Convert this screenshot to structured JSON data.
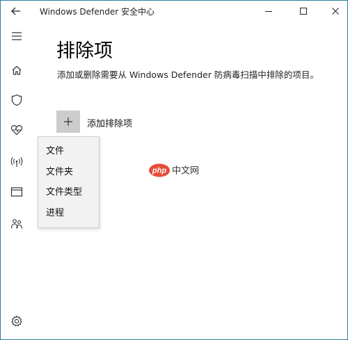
{
  "window": {
    "title": "Windows Defender 安全中心",
    "accent_color": "#2d7d9a"
  },
  "titlebar": {
    "back_icon": "arrow-left-icon",
    "minimize_icon": "minimize-icon",
    "maximize_icon": "maximize-icon",
    "close_icon": "close-icon"
  },
  "rail": {
    "items": [
      {
        "icon": "hamburger-menu-icon"
      },
      {
        "icon": "home-icon"
      },
      {
        "icon": "shield-icon"
      },
      {
        "icon": "heart-pulse-icon"
      },
      {
        "icon": "wireless-signal-icon"
      },
      {
        "icon": "browser-window-icon"
      },
      {
        "icon": "family-icon"
      },
      {
        "icon": "gear-icon"
      }
    ]
  },
  "main": {
    "title": "排除项",
    "description": "添加或删除需要从 Windows Defender 防病毒扫描中排除的项目。",
    "add_button_icon": "plus-icon",
    "add_label": "添加排除项"
  },
  "menu": {
    "items": [
      "文件",
      "文件夹",
      "文件类型",
      "进程"
    ]
  },
  "watermark": {
    "logo_text": "php",
    "text": "中文网",
    "logo_color": "#e74c3c"
  }
}
